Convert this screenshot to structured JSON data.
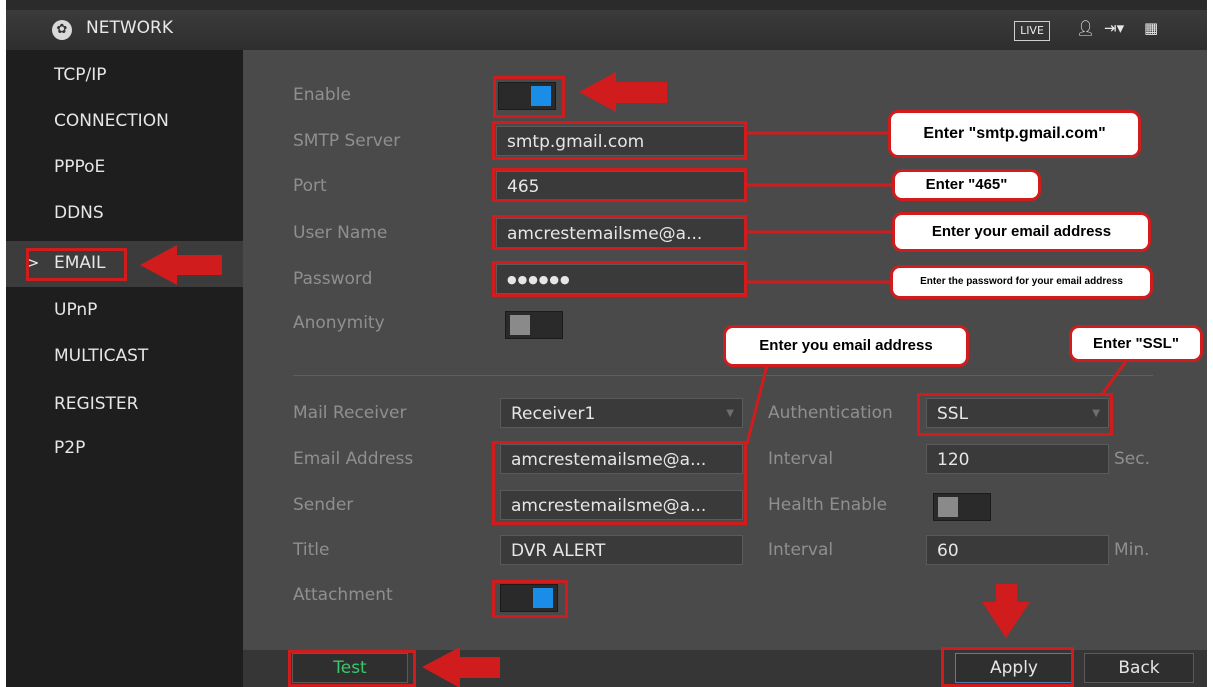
{
  "titlebar": {
    "title": "NETWORK",
    "live_label": "LIVE"
  },
  "sidebar": {
    "items": [
      {
        "label": "TCP/IP"
      },
      {
        "label": "CONNECTION"
      },
      {
        "label": "PPPoE"
      },
      {
        "label": "DDNS"
      },
      {
        "label": "EMAIL",
        "active": true
      },
      {
        "label": "UPnP"
      },
      {
        "label": "MULTICAST"
      },
      {
        "label": "REGISTER"
      },
      {
        "label": "P2P"
      }
    ],
    "active_marker": ">"
  },
  "form": {
    "enable_label": "Enable",
    "enable_on": true,
    "smtp_label": "SMTP Server",
    "smtp_value": "smtp.gmail.com",
    "port_label": "Port",
    "port_value": "465",
    "username_label": "User Name",
    "username_value": "amcrestemailsme@a...",
    "password_label": "Password",
    "password_value": "●●●●●●",
    "anonymity_label": "Anonymity",
    "anonymity_on": false,
    "receiver_label": "Mail Receiver",
    "receiver_value": "Receiver1",
    "email_label": "Email Address",
    "email_value": "amcrestemailsme@a...",
    "sender_label": "Sender",
    "sender_value": "amcrestemailsme@a...",
    "title_label": "Title",
    "title_value": "DVR ALERT",
    "attachment_label": "Attachment",
    "attachment_on": true,
    "auth_label": "Authentication",
    "auth_value": "SSL",
    "interval1_label": "Interval",
    "interval1_value": "120",
    "interval1_unit": "Sec.",
    "health_label": "Health Enable",
    "health_on": false,
    "interval2_label": "Interval",
    "interval2_value": "60",
    "interval2_unit": "Min."
  },
  "buttons": {
    "test": "Test",
    "apply": "Apply",
    "back": "Back"
  },
  "callouts": {
    "smtp": "Enter \"smtp.gmail.com\"",
    "port": "Enter \"465\"",
    "username": "Enter your email address",
    "password": "Enter the password for your email address",
    "email": "Enter you email address",
    "ssl": "Enter \"SSL\""
  },
  "colors": {
    "annotation_red": "#d01c1c",
    "toggle_on": "#1a8ee6",
    "test_text": "#38c86a"
  }
}
